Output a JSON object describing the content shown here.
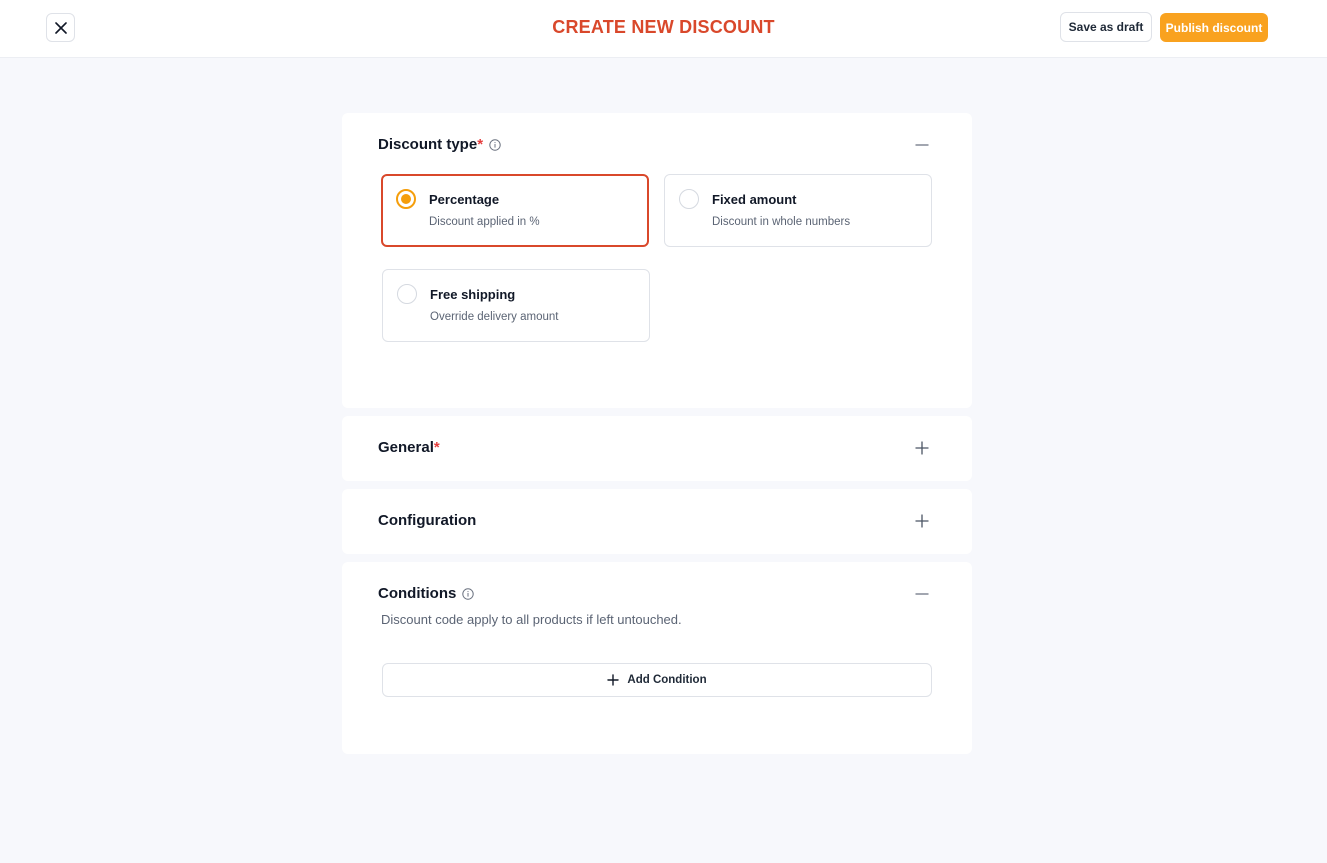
{
  "header": {
    "title": "CREATE NEW DISCOUNT",
    "save_draft_label": "Save as draft",
    "publish_label": "Publish discount"
  },
  "sections": {
    "discount_type": {
      "title": "Discount type",
      "required_marker": "*",
      "options": [
        {
          "title": "Percentage",
          "description": "Discount applied in %",
          "selected": true
        },
        {
          "title": "Fixed amount",
          "description": "Discount in whole numbers",
          "selected": false
        },
        {
          "title": "Free shipping",
          "description": "Override delivery amount",
          "selected": false
        }
      ]
    },
    "general": {
      "title": "General",
      "required_marker": "*"
    },
    "configuration": {
      "title": "Configuration"
    },
    "conditions": {
      "title": "Conditions",
      "description": "Discount code apply to all products if left untouched.",
      "add_label": "Add Condition"
    }
  },
  "colors": {
    "accent": "#d9482b",
    "publish": "#f9a21f",
    "background": "#f7f8fc",
    "required": "#e53e3e"
  }
}
